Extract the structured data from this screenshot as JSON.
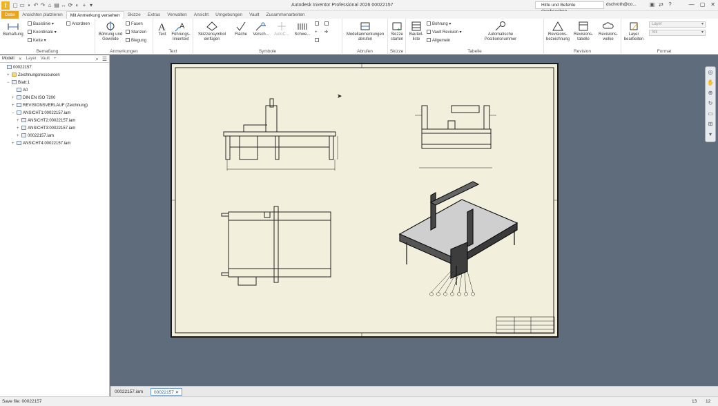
{
  "app": {
    "title": "Autodesk Inventor Professional 2026   00022157",
    "logo": "I"
  },
  "search": {
    "placeholder": "Hilfe und Befehle durchsuchen..."
  },
  "user": {
    "name": "dschroth@co..."
  },
  "tabs": [
    "Datei",
    "Ansichten platzieren",
    "Mit Anmerkung versehen",
    "Skizze",
    "Extras",
    "Verwalten",
    "Ansicht",
    "Umgebungen",
    "Vault",
    "Zusammenarbeiten"
  ],
  "active_tab": "Mit Anmerkung versehen",
  "ribbon": {
    "bemassung": {
      "title": "Bemaßung",
      "main": "Bemaßung",
      "small": [
        "Basislinie",
        "Koordinate",
        "Kette",
        "Anordnen"
      ]
    },
    "anmerkungen": {
      "title": "Anmerkungen",
      "main": "Bohrung und Gewinde",
      "small": [
        "Fasen",
        "Stanzen",
        "Biegung"
      ]
    },
    "text": {
      "title": "Text",
      "items": [
        "Text",
        "Führungs-linientext"
      ]
    },
    "symbole": {
      "title": "Symbole",
      "items": [
        "Skizzensymbol einfügen",
        "Fläche",
        "Versch...",
        "AutoC...",
        "Schwe..."
      ]
    },
    "abrufen": {
      "title": "Abrufen",
      "main": "Modellanmerkungen abrufen"
    },
    "skizze": {
      "title": "Skizze",
      "main": "Skizze starten"
    },
    "tabelle": {
      "title": "Tabelle",
      "main": "Bauteil-liste",
      "small": [
        "Bohrung",
        "Vault Revision",
        "Allgemein"
      ],
      "auto": "Automatische Positionsnummer"
    },
    "revision": {
      "title": "Revision",
      "items": [
        "Revisions-bezeichnung",
        "Revisions-tabelle",
        "Revisions-wolke"
      ]
    },
    "format": {
      "title": "Format",
      "layer_edit": "Layer bearbeiten",
      "layer_dd": "Layer",
      "style_dd": "Stil"
    }
  },
  "browser": {
    "tabs": [
      "Modell",
      "Layer",
      "Vault"
    ],
    "tree": [
      {
        "label": "00022157",
        "indent": 0,
        "toggle": "",
        "icon": "drawing-icon"
      },
      {
        "label": "Zeichnungsressourcen",
        "indent": 1,
        "toggle": "+",
        "icon": "folder-icon"
      },
      {
        "label": "Blatt:1",
        "indent": 1,
        "toggle": "−",
        "icon": "sheet-icon"
      },
      {
        "label": "A0",
        "indent": 2,
        "toggle": "",
        "icon": "sheet-format-icon"
      },
      {
        "label": "DIN EN ISO 7200",
        "indent": 2,
        "toggle": "+",
        "icon": "title-block-icon"
      },
      {
        "label": "REVISIONSVERLAUF (Zeichnung)",
        "indent": 2,
        "toggle": "+",
        "icon": "table-icon"
      },
      {
        "label": "ANSICHT1:00022157.iam",
        "indent": 2,
        "toggle": "−",
        "icon": "view-icon"
      },
      {
        "label": "ANSICHT2:00022157.iam",
        "indent": 3,
        "toggle": "+",
        "icon": "view-icon"
      },
      {
        "label": "ANSICHT3:00022157.iam",
        "indent": 3,
        "toggle": "+",
        "icon": "view-icon"
      },
      {
        "label": "00022157.iam",
        "indent": 3,
        "toggle": "+",
        "icon": "assembly-icon"
      },
      {
        "label": "ANSICHT4:00022157.iam",
        "indent": 2,
        "toggle": "+",
        "icon": "view-icon"
      }
    ]
  },
  "doc_tabs": [
    "00022157.iam",
    "00022157"
  ],
  "active_doc": "00022157",
  "status": {
    "text": "Save file: 00022157",
    "count1": "13",
    "count2": "12"
  }
}
